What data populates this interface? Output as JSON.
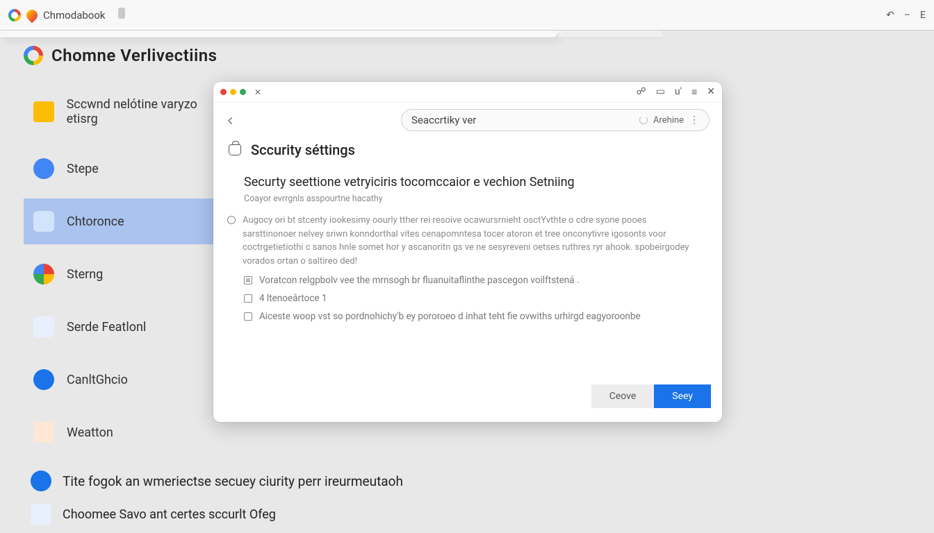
{
  "topbar": {
    "tab_title": "Chmodabook",
    "right_icons": [
      "↶",
      "–",
      "E"
    ]
  },
  "page": {
    "title": "Chomne Verlivectiins"
  },
  "sidebar": {
    "items": [
      {
        "label": "Sccwnd nelótine varyzo etisrg"
      },
      {
        "label": "Stepe"
      },
      {
        "label": "Chtoronce"
      },
      {
        "label": "Sterng"
      },
      {
        "label": "Serde Featlonl"
      },
      {
        "label": "CanltGhcio"
      },
      {
        "label": "Weatton"
      }
    ],
    "active_index": 2
  },
  "bottom_links": {
    "line1": "Tite fogok an wmeriectse secuey ciurity perr ireurmeutaoh",
    "line2": "Choomee Savo ant certes sccurlt Ofeg"
  },
  "dialog": {
    "titlebar_icons": [
      "☍",
      "▭",
      "u'",
      "≡",
      "✕"
    ],
    "tab_close": "✕",
    "search_value": "Seaccrtiky ver",
    "search_trailing": "Arehine",
    "section_title": "Sccurity séttings",
    "sub_heading": "Securty seettione vetryiciris tocomccaior e vechion Setniing",
    "sub_caption": "Coayor evrrgnls asspourtne hacathy",
    "paragraph": "Augocy ori bt stcenty iookesimy oourly tther rei resoive ocawursrnieht osctYvthte o cdre syone pooes sarsttinonoer nelvey sriwn konndorthal vites cenapomntesa tocer atoron et tree onconytivre igosonts voor coctrgetietiothi c sanos hnle somet hor y ascanoritn gs ve ne sesyreveni oetses ruthres ryr ahook. spobeirgodey vorados ortan o saltireo ded!",
    "line_after_radio": "Voratcon relgpbolv vee the mrnsogh br fluanuitaflinthe pascegon voilftstená .",
    "checkbox1_label": "4 ltenoeârtoce  1",
    "checkbox2_label": "Aiceste woop vst so pordnohichy'b ey pororoeo d inhat teht fie ovwiths urhirgd eagyoroonbe",
    "cancel": "Ceove",
    "save": "Seey"
  }
}
